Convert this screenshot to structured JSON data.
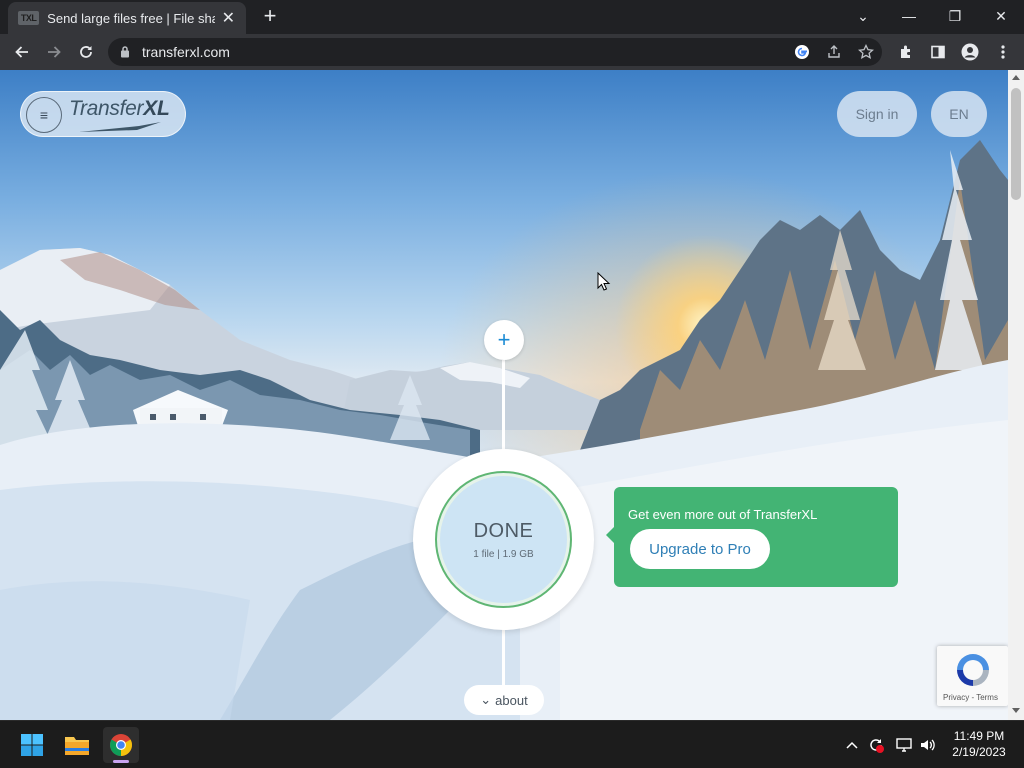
{
  "browser": {
    "tab": {
      "favicon_text": "TXL",
      "title": "Send large files free | File sharing",
      "close": "✕"
    },
    "new_tab": "+",
    "window_controls": {
      "dropdown": "⌄",
      "minimize": "—",
      "restore": "❐",
      "close": "✕"
    },
    "address": {
      "url": "transferxl.com"
    }
  },
  "page": {
    "logo": {
      "text_light": "Transfer",
      "text_bold": "XL"
    },
    "menu_icon": "≡",
    "sign_in": "Sign in",
    "language": "EN",
    "add_button": "+",
    "status": {
      "label": "DONE",
      "file_info": "1 file | 1.9 GB"
    },
    "promo": {
      "text": "Get even more out of TransferXL",
      "button": "Upgrade to Pro"
    },
    "about": {
      "chevron": "⌄",
      "label": "about"
    },
    "recaptcha": {
      "links": "Privacy - Terms"
    }
  },
  "taskbar": {
    "clock": {
      "time": "11:49 PM",
      "date": "2/19/2023"
    }
  },
  "colors": {
    "promo_green": "#43b474",
    "accent_blue": "#1a8ad4",
    "done_ring": "#5fb673"
  }
}
